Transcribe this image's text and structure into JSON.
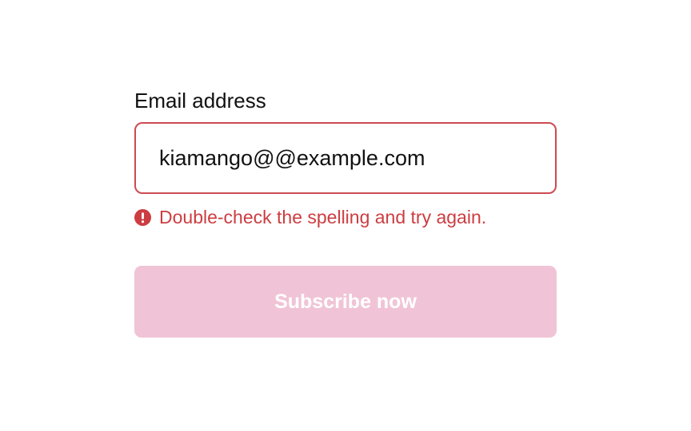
{
  "form": {
    "email_label": "Email address",
    "email_value": "kiamango@@example.com",
    "error_message": "Double-check the spelling and try again.",
    "error_icon": "exclamation-circle-icon",
    "submit_label": "Subscribe now",
    "submit_disabled": true
  },
  "colors": {
    "error": "#cc3d41",
    "input_border_error": "#cc4b52",
    "button_disabled_bg": "#f0c4d6",
    "button_text": "#ffffff",
    "text": "#111111"
  }
}
